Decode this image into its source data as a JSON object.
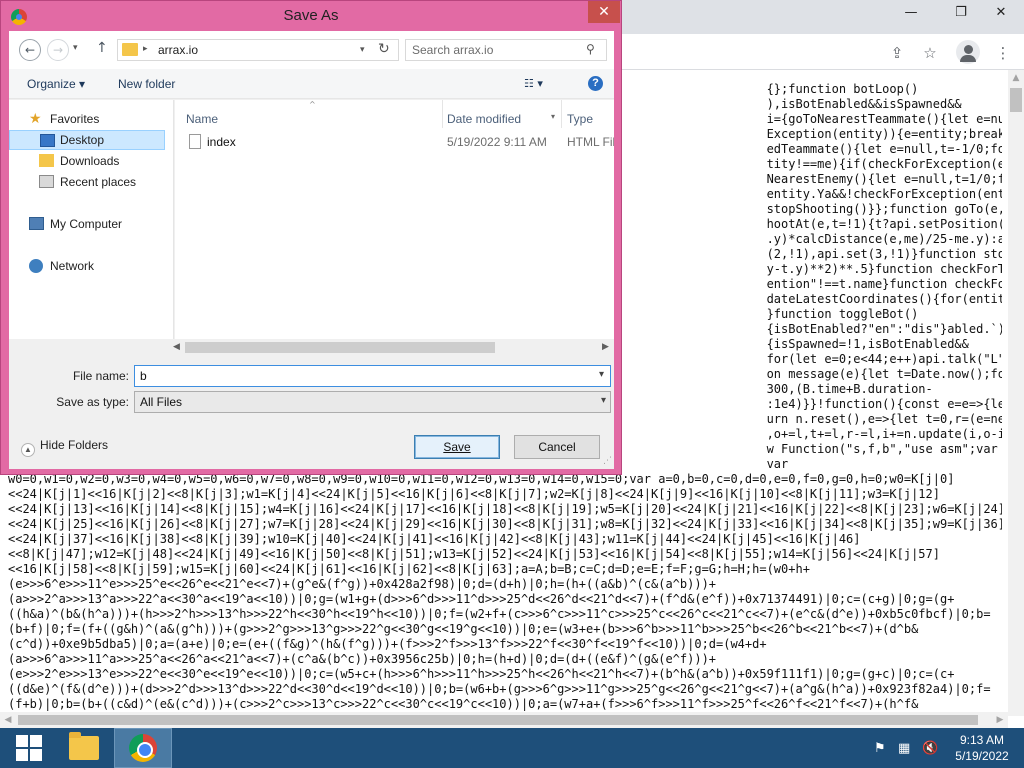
{
  "browser": {
    "window_controls": {
      "minimize": "—",
      "restore": "❐",
      "close": "✕"
    },
    "code_lines": [
      "                                                                                                         {};function botLoop()",
      "                                                                                                         ),isBotEnabled&&isSpawned&&",
      "                                                                                                         i={goToNearestTeammate(){let e=null,t=1/0;for(entity",
      "                                                                                                         Exception(entity)){e=entity;break}let",
      "                                                                                                         edTeammate(){let e=null,t=-1/0;for(entity of",
      "                                                                                                         tity!==me){if(checkForException(entity))",
      "                                                                                                         NearestEnemy(){let e=null,t=1/0;for(entity of",
      "                                                                                                         entity.Ya&&!checkForException(entity)&&entity.id in",
      "                                                                                                         stopShooting()}};function goTo(e,t=0){api.set(0,e.y-",
      "                                                                                                         hootAt(e,t=!1){t?api.setPosition(e.x+(e.x-",
      "                                                                                                         .y)*calcDistance(e,me)/25-me.y):api.setPosition(e.x-",
      "                                                                                                         (2,!1),api.set(3,!1)}function stopShooting()",
      "                                                                                                         y-t.y)**2)**.5}function checkForTank(e){let",
      "                                                                                                         ention\"!==t.name}function checkForException(e)",
      "                                                                                                         dateLatestCoordinates(){for(entity",
      "                                                                                                         }function toggleBot()",
      "                                                                                                         {isBotEnabled?\"en\":\"dis\"}abled.`)}function onSpawn()",
      "                                                                                                         {isSpawned=!1,isBotEnabled&&",
      "                                                                                                         for(let e=0;e<44;e++)api.talk(\"L\");for(upgrade of",
      "                                                                                                         on message(e){let t=Date.now();for(B of",
      "                                                                                                         300,(B.time+B.duration-",
      "                                                                                                         :1e4)}}!function(){const e=e=>{let t=new",
      "                                                                                                         urn n.reset(),e=>{let t=0,r=(e=new",
      "                                                                                                         ,o+=l,t+=l,r-=l,i+=n.update(i,o-i),i===o&&",
      "                                                                                                         w Function(\"s,f,b\",\"use asm\";var",
      "                                                                                                         var",
      "w0=0,w1=0,w2=0,w3=0,w4=0,w5=0,w6=0,w7=0,w8=0,w9=0,w10=0,w11=0,w12=0,w13=0,w14=0,w15=0;var a=0,b=0,c=0,d=0,e=0,f=0,g=0,h=0;w0=K[j|0]",
      "<<24|K[j|1]<<16|K[j|2]<<8|K[j|3];w1=K[j|4]<<24|K[j|5]<<16|K[j|6]<<8|K[j|7];w2=K[j|8]<<24|K[j|9]<<16|K[j|10]<<8|K[j|11];w3=K[j|12]",
      "<<24|K[j|13]<<16|K[j|14]<<8|K[j|15];w4=K[j|16]<<24|K[j|17]<<16|K[j|18]<<8|K[j|19];w5=K[j|20]<<24|K[j|21]<<16|K[j|22]<<8|K[j|23];w6=K[j|24]",
      "<<24|K[j|25]<<16|K[j|26]<<8|K[j|27];w7=K[j|28]<<24|K[j|29]<<16|K[j|30]<<8|K[j|31];w8=K[j|32]<<24|K[j|33]<<16|K[j|34]<<8|K[j|35];w9=K[j|36]",
      "<<24|K[j|37]<<16|K[j|38]<<8|K[j|39];w10=K[j|40]<<24|K[j|41]<<16|K[j|42]<<8|K[j|43];w11=K[j|44]<<24|K[j|45]<<16|K[j|46]",
      "<<8|K[j|47];w12=K[j|48]<<24|K[j|49]<<16|K[j|50]<<8|K[j|51];w13=K[j|52]<<24|K[j|53]<<16|K[j|54]<<8|K[j|55];w14=K[j|56]<<24|K[j|57]",
      "<<16|K[j|58]<<8|K[j|59];w15=K[j|60]<<24|K[j|61]<<16|K[j|62]<<8|K[j|63];a=A;b=B;c=C;d=D;e=E;f=F;g=G;h=H;h=(w0+h+",
      "(e>>>6^e>>>11^e>>>25^e<<26^e<<21^e<<7)+(g^e&(f^g))+0x428a2f98)|0;d=(d+h)|0;h=(h+((a&b)^(c&(a^b)))+",
      "(a>>>2^a>>>13^a>>>22^a<<30^a<<19^a<<10))|0;g=(w1+g+(d>>>6^d>>>11^d>>>25^d<<26^d<<21^d<<7)+(f^d&(e^f))+0x71374491)|0;c=(c+g)|0;g=(g+",
      "((h&a)^(b&(h^a)))+(h>>>2^h>>>13^h>>>22^h<<30^h<<19^h<<10))|0;f=(w2+f+(c>>>6^c>>>11^c>>>25^c<<26^c<<21^c<<7)+(e^c&(d^e))+0xb5c0fbcf)|0;b=",
      "(b+f)|0;f=(f+((g&h)^(a&(g^h)))+(g>>>2^g>>>13^g>>>22^g<<30^g<<19^g<<10))|0;e=(w3+e+(b>>>6^b>>>11^b>>>25^b<<26^b<<21^b<<7)+(d^b&",
      "(c^d))+0xe9b5dba5)|0;a=(a+e)|0;e=(e+((f&g)^(h&(f^g)))+(f>>>2^f>>>13^f>>>22^f<<30^f<<19^f<<10))|0;d=(w4+d+",
      "(a>>>6^a>>>11^a>>>25^a<<26^a<<21^a<<7)+(c^a&(b^c))+0x3956c25b)|0;h=(h+d)|0;d=(d+((e&f)^(g&(e^f)))+",
      "(e>>>2^e>>>13^e>>>22^e<<30^e<<19^e<<10))|0;c=(w5+c+(h>>>6^h>>>11^h>>>25^h<<26^h<<21^h<<7)+(b^h&(a^b))+0x59f111f1)|0;g=(g+c)|0;c=(c+",
      "((d&e)^(f&(d^e)))+(d>>>2^d>>>13^d>>>22^d<<30^d<<19^d<<10))|0;b=(w6+b+(g>>>6^g>>>11^g>>>25^g<<26^g<<21^g<<7)+(a^g&(h^a))+0x923f82a4)|0;f=",
      "(f+b)|0;b=(b+((c&d)^(e&(c^d)))+(c>>>2^c>>>13^c>>>22^c<<30^c<<19^c<<10))|0;a=(w7+a+(f>>>6^f>>>11^f>>>25^f<<26^f<<21^f<<7)+(h^f&"
    ]
  },
  "dialog": {
    "title": "Save As",
    "close": "✕",
    "breadcrumb": "arrax.io",
    "search_placeholder": "Search arrax.io",
    "organize": "Organize ▾",
    "new_folder": "New folder",
    "help": "?",
    "nav": {
      "favorites": "Favorites",
      "desktop": "Desktop",
      "downloads": "Downloads",
      "recent": "Recent places",
      "computer": "My Computer",
      "network": "Network"
    },
    "columns": {
      "name": "Name",
      "date": "Date modified",
      "type": "Type"
    },
    "files": [
      {
        "name": "index",
        "date": "5/19/2022 9:11 AM",
        "type": "HTML File"
      }
    ],
    "file_name_label": "File name:",
    "file_name_value": "b",
    "save_type_label": "Save as type:",
    "save_type_value": "All Files",
    "hide_folders": "Hide Folders",
    "save_button": "Save",
    "cancel_button": "Cancel"
  },
  "taskbar": {
    "time": "9:13 AM",
    "date": "5/19/2022"
  }
}
